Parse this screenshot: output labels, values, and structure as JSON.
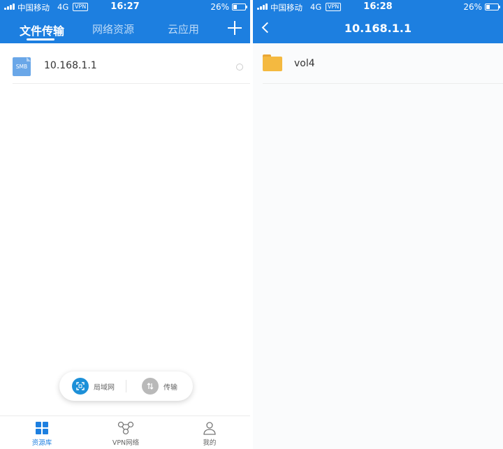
{
  "left_screen": {
    "status_bar": {
      "carrier": "中国移动",
      "network": "4G",
      "vpn": "VPN",
      "time": "16:27",
      "battery": "26%"
    },
    "tabs": [
      {
        "label": "文件传输",
        "active": true
      },
      {
        "label": "网络资源",
        "active": false
      },
      {
        "label": "云应用",
        "active": false
      }
    ],
    "add_icon": "plus-icon",
    "list": [
      {
        "icon": "smb-icon",
        "icon_text": "SMB",
        "label": "10.168.1.1"
      }
    ],
    "floating_bar": {
      "lan_label": "局域网",
      "transfer_label": "传输"
    },
    "bottom_nav": [
      {
        "label": "资源库",
        "icon": "grid-icon",
        "active": true
      },
      {
        "label": "VPN网络",
        "icon": "network-icon",
        "active": false
      },
      {
        "label": "我的",
        "icon": "person-icon",
        "active": false
      }
    ]
  },
  "right_screen": {
    "status_bar": {
      "carrier": "中国移动",
      "network": "4G",
      "vpn": "VPN",
      "time": "16:28",
      "battery": "26%"
    },
    "title": "10.168.1.1",
    "back_icon": "chevron-left-icon",
    "list": [
      {
        "icon": "folder-icon",
        "label": "vol4"
      }
    ]
  },
  "colors": {
    "header": "#1d7fe0",
    "folder": "#f4b940",
    "smb": "#6aa7e8",
    "accent": "#1d90d8"
  }
}
